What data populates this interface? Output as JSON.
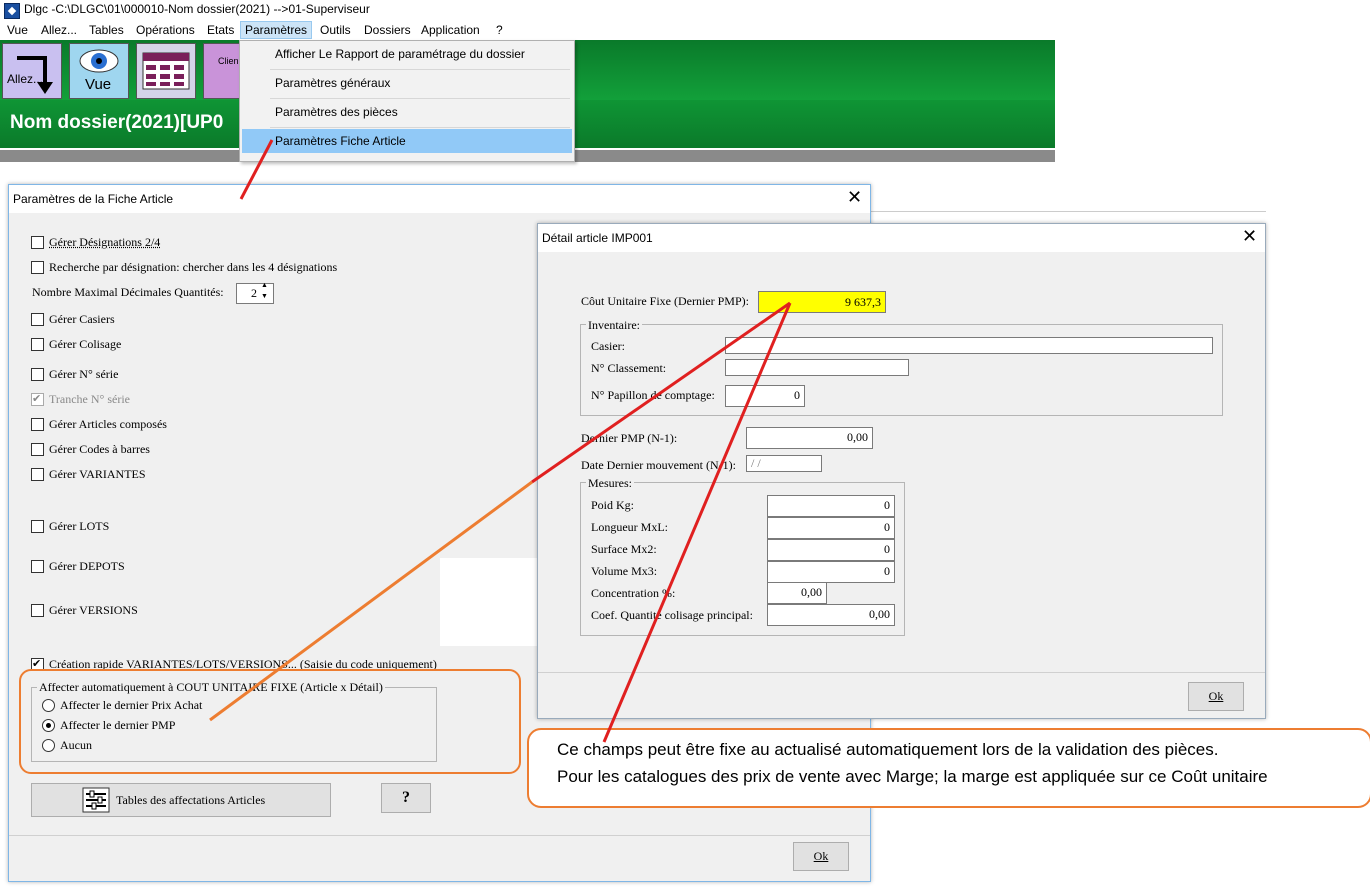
{
  "app": {
    "title": "Dlgc -C:\\DLGC\\01\\000010-Nom dossier(2021) -->01-Superviseur",
    "menu": [
      "Vue",
      "Allez...",
      "Tables",
      "Opérations",
      "Etats",
      "Paramètres",
      "Outils",
      "Dossiers",
      "Application",
      "?"
    ],
    "toolbar": {
      "allez_label": "Allez...",
      "vue_label": "Vue",
      "clients_label": "Clien"
    },
    "banner_title": "Nom dossier(2021)[UP0"
  },
  "dropdown": {
    "items": [
      "Afficher Le Rapport de paramétrage du dossier",
      "Paramètres généraux",
      "Paramètres des pièces",
      "Paramètres Fiche Article"
    ],
    "selected_index": 3
  },
  "dialog1": {
    "title": "Paramètres de la Fiche Article",
    "checkboxes": [
      {
        "label": "Gérer Désignations 2/4",
        "checked": false
      },
      {
        "label": "Recherche par désignation: chercher dans les 4 désignations",
        "checked": false
      },
      {
        "label": "Gérer Casiers",
        "checked": false
      },
      {
        "label": "Gérer Colisage",
        "checked": false
      },
      {
        "label": "Gérer N° série",
        "checked": false
      },
      {
        "label": "Tranche N° série",
        "checked": true,
        "disabled": true
      },
      {
        "label": "Gérer Articles composés",
        "checked": false
      },
      {
        "label": "Gérer Codes à barres",
        "checked": false
      },
      {
        "label": "Gérer VARIANTES",
        "checked": false
      },
      {
        "label": "Gérer LOTS",
        "checked": false
      },
      {
        "label": "Gérer DEPOTS",
        "checked": false
      },
      {
        "label": "Gérer VERSIONS",
        "checked": false
      },
      {
        "label": "Création rapide VARIANTES/LOTS/VERSIONS... (Saisie du code uniquement)",
        "checked": true
      }
    ],
    "decimals_label": "Nombre Maximal Décimales Quantités:",
    "decimals_value": "2",
    "group_title": "Affecter automatiquement à COUT UNITAIRE FIXE (Article x Détail)",
    "radios": [
      {
        "label": "Affecter le dernier Prix Achat",
        "on": false
      },
      {
        "label": "Affecter le dernier PMP",
        "on": true
      },
      {
        "label": "Aucun",
        "on": false
      }
    ],
    "tables_button": "Tables des affectations Articles",
    "help_button": "?",
    "ok_button": "Ok"
  },
  "dialog2": {
    "title": "Détail article IMP001",
    "cout_label": "Côut Unitaire Fixe (Dernier PMP):",
    "cout_value": "9 637,3",
    "inventaire_title": "Inventaire:",
    "casier_label": "Casier:",
    "casier_value": "",
    "classement_label": "N° Classement:",
    "classement_value": "",
    "papillon_label": "N° Papillon de comptage:",
    "papillon_value": "0",
    "pmp_label": "Dernier PMP (N-1):",
    "pmp_value": "0,00",
    "date_label": "Date Dernier mouvement (N-1):",
    "date_value": " / /",
    "mesures_title": "Mesures:",
    "mesures": [
      {
        "label": "Poid Kg:",
        "value": "0"
      },
      {
        "label": "Longueur MxL:",
        "value": "0"
      },
      {
        "label": "Surface Mx2:",
        "value": "0"
      },
      {
        "label": "Volume Mx3:",
        "value": "0"
      }
    ],
    "concentration_label": "Concentration %:",
    "concentration_value": "0,00",
    "coef_label": "Coef. Quantité colisage principal:",
    "coef_value": "0,00",
    "ok_button": "Ok"
  },
  "note": {
    "line1": "Ce champs peut être fixe au actualisé automatiquement lors de la validation des pièces.",
    "line2": "Pour les catalogues des prix de vente avec Marge; la marge est appliquée sur ce Coût unitaire"
  },
  "colors": {
    "accent_red": "#e02020",
    "accent_orange": "#ed7d31",
    "highlight_yellow": "#ffff00",
    "banner_green": "#0f9535"
  }
}
